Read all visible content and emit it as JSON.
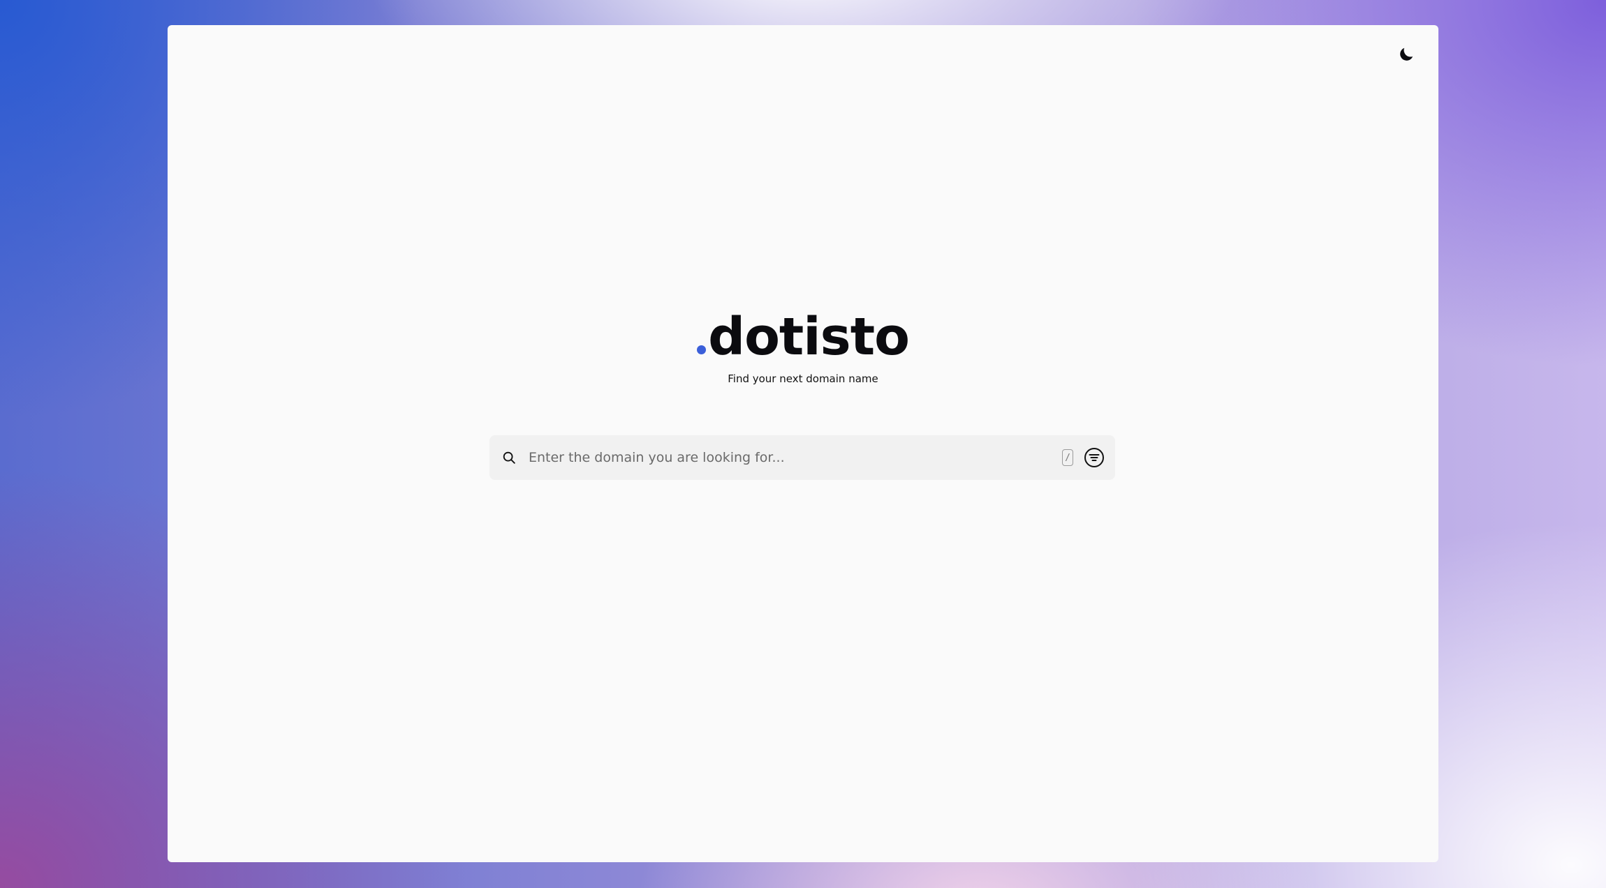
{
  "brand": {
    "logo_text": "dotisto",
    "tagline": "Find your next domain name",
    "accent_color": "#3b5fd9"
  },
  "header": {
    "theme_toggle_icon": "moon-icon"
  },
  "search": {
    "placeholder": "Enter the domain you are looking for...",
    "value": "",
    "shortcut_hint": "/",
    "search_icon": "search-icon",
    "filter_icon": "filter-icon"
  }
}
